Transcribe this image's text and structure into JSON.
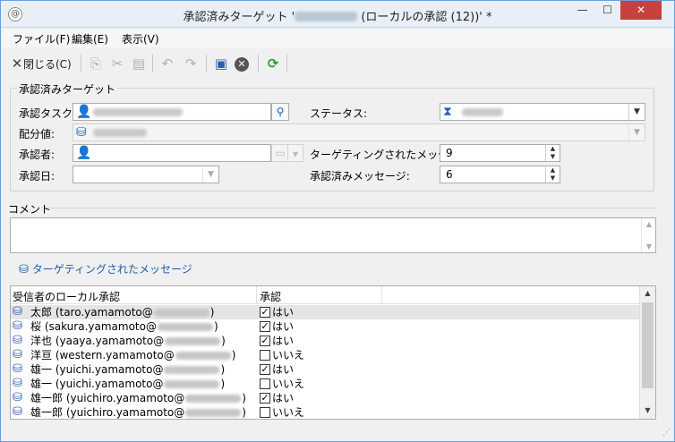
{
  "window": {
    "app_icon": "@",
    "title_prefix": "承認済みターゲット '",
    "title_suffix": " (ローカルの承認 (12))' *",
    "min": "—",
    "max": "☐",
    "close": "✕"
  },
  "menu": [
    "ファイル(F)",
    "編集(E)",
    "表示(V)"
  ],
  "toolbar": {
    "close_label": "閉じる(C)",
    "icons": [
      "copy-icon",
      "cut-icon",
      "paste-icon",
      "undo-icon",
      "redo-icon",
      "save-icon",
      "cancel-icon",
      "refresh-icon"
    ]
  },
  "form": {
    "group_title": "承認済みターゲット",
    "task_label": "承認タスク:",
    "status_label": "ステータス:",
    "distribution_label": "配分値:",
    "approver_label": "承認者:",
    "approval_date_label": "承認日:",
    "targeted_messages_label": "ターゲティングされたメッセージ:",
    "targeted_messages_value": "9",
    "approved_messages_label": "承認済みメッセージ:",
    "approved_messages_value": "6"
  },
  "comment": {
    "label": "コメント"
  },
  "messages_link": "ターゲティングされたメッセージ",
  "list": {
    "headers": [
      "受信者のローカル承認",
      "承認"
    ],
    "rows": [
      {
        "name": "太郎 (taro.yamamoto@",
        "end": ")",
        "checked": true,
        "approval": "はい"
      },
      {
        "name": "桜 (sakura.yamamoto@",
        "end": ")",
        "checked": true,
        "approval": "はい"
      },
      {
        "name": "洋也 (yaaya.yamamoto@",
        "end": ")",
        "checked": true,
        "approval": "はい"
      },
      {
        "name": "洋亘 (western.yamamoto@",
        "end": ")",
        "checked": false,
        "approval": "いいえ"
      },
      {
        "name": "雄一 (yuichi.yamamoto@",
        "end": ")",
        "checked": true,
        "approval": "はい"
      },
      {
        "name": "雄一 (yuichi.yamamoto@",
        "end": ")",
        "checked": false,
        "approval": "いいえ"
      },
      {
        "name": "雄一郎 (yuichiro.yamamoto@",
        "end": ")",
        "checked": true,
        "approval": "はい"
      },
      {
        "name": "雄一郎 (yuichiro.yamamoto@",
        "end": ")",
        "checked": false,
        "approval": "いいえ"
      }
    ]
  },
  "colors": {
    "accent": "#1a5ea8",
    "refresh": "#2e9b3a",
    "save": "#2b5fb3",
    "cancel": "#555555"
  }
}
